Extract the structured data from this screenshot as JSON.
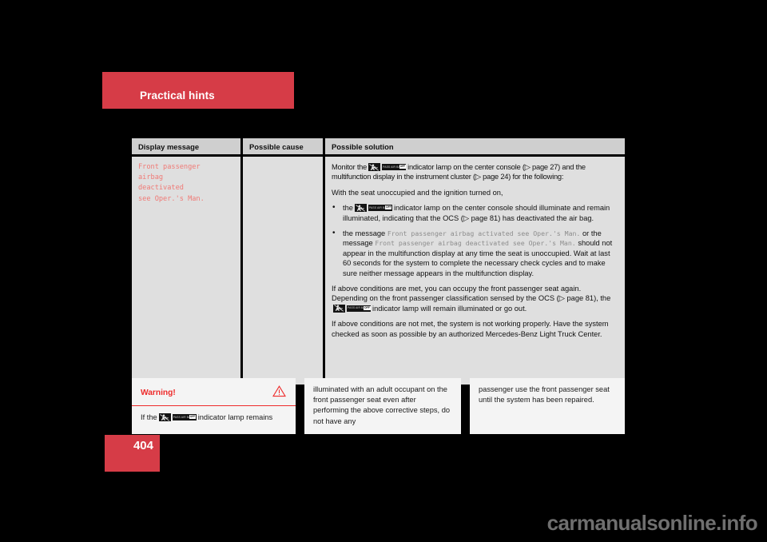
{
  "page": {
    "chapter_title": "Practical hints",
    "page_number": "404",
    "watermark": "carmanualsonline.info",
    "accent_color": "#d63c47",
    "warning_color": "#ee2b2b",
    "display_message_color": "#f07a76",
    "table_header_bg": "#cfcfcf",
    "table_body_bg": "#dfdfdf"
  },
  "table": {
    "headers": {
      "display_message": "Display message",
      "possible_cause": "Possible cause",
      "possible_solution": "Possible solution"
    },
    "row": {
      "display_message": "Front passenger\nairbag\ndeactivated\nsee Oper.'s Man.",
      "possible_cause": "",
      "solution": {
        "intro_1a": "Monitor the",
        "intro_1b": "indicator lamp on the center console (▷ page 27) and the multifunction display in the instrument cluster (▷ page 24) for the following:",
        "intro_2": "With the seat unoccupied and the ignition turned on,",
        "bullets": [
          {
            "pre": "the",
            "post": "indicator lamp on the center console should illuminate and remain illuminated, indicating that the OCS (▷ page 81) has deactivated the air bag."
          },
          {
            "b1": "the message",
            "m1": "Front passenger airbag activated see Oper.'s Man.",
            "b2": "or the message",
            "m2": "Front passenger airbag deactivated see Oper.'s Man.",
            "b3": "should not appear in the multifunction display at any time the seat is unoccupied. Wait at last 60 seconds for the system to complete the necessary check cycles and to make sure neither message appears in the multifunction display."
          }
        ],
        "para_3a": "If above conditions are met, you can occupy the front passenger seat again. Depending on the front passenger classification sensed by the OCS (▷ page 81), the",
        "para_3b": "indicator lamp will remain illuminated or go out.",
        "para_4": "If above conditions are not met, the system is not working properly. Have the system checked as soon as possible by an authorized Mercedes-Benz Light Truck Center."
      }
    }
  },
  "icons": {
    "lamp_text_label": "PASS AIR BAG",
    "lamp_text_off": "OFF",
    "figure_icon": "passenger-airbag-figure-icon",
    "warning_triangle": "warning-triangle-icon"
  },
  "warning": {
    "title": "Warning!",
    "col1_pre": "If the",
    "col1_post": "indicator lamp remains",
    "col2": "illuminated with an adult occupant on the front passenger seat even after performing the above corrective steps, do not have any",
    "col3": "passenger use the front passenger seat until the system has been repaired."
  }
}
